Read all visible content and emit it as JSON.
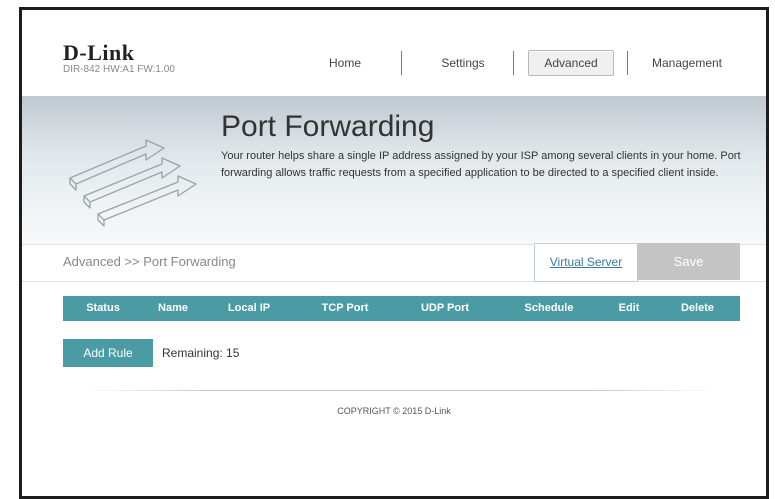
{
  "header": {
    "logo": "D-Link",
    "model_info": "DIR-842   HW:A1   FW:1.00",
    "nav": [
      {
        "label": "Home"
      },
      {
        "label": "Settings"
      },
      {
        "label": "Advanced"
      },
      {
        "label": "Management"
      }
    ]
  },
  "hero": {
    "title": "Port Forwarding",
    "description": "Your router helps share a single IP address assigned by your ISP among several clients in your home. Port forwarding allows traffic requests from a specified application to be directed to a specified client inside.",
    "icon": "port-forwarding-arrows-icon"
  },
  "toolbar": {
    "breadcrumb": "Advanced >> Port Forwarding",
    "virtual_server_label": "Virtual Server",
    "save_label": "Save"
  },
  "table": {
    "columns": [
      "Status",
      "Name",
      "Local IP",
      "TCP Port",
      "UDP Port",
      "Schedule",
      "Edit",
      "Delete"
    ],
    "rows": []
  },
  "rules": {
    "add_label": "Add Rule",
    "remaining_text": "Remaining: 15"
  },
  "footer": {
    "copyright": "COPYRIGHT © 2015 D-Link"
  },
  "colors": {
    "accent": "#4b9ba5",
    "save_disabled": "#c4c4c4",
    "link": "#3c7a9c"
  }
}
